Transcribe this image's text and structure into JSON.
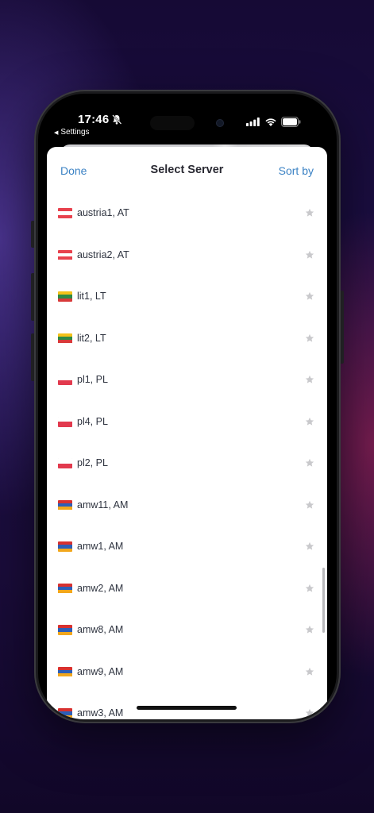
{
  "status_bar": {
    "time": "17:46",
    "back_label": "Settings"
  },
  "nav": {
    "done": "Done",
    "title": "Select Server",
    "sort": "Sort by"
  },
  "servers": [
    {
      "label": "austria1, AT",
      "country": "AT"
    },
    {
      "label": "austria2, AT",
      "country": "AT"
    },
    {
      "label": "lit1, LT",
      "country": "LT"
    },
    {
      "label": "lit2, LT",
      "country": "LT"
    },
    {
      "label": "pl1, PL",
      "country": "PL"
    },
    {
      "label": "pl4, PL",
      "country": "PL"
    },
    {
      "label": "pl2, PL",
      "country": "PL"
    },
    {
      "label": "amw11, AM",
      "country": "AM"
    },
    {
      "label": "amw1, AM",
      "country": "AM"
    },
    {
      "label": "amw2, AM",
      "country": "AM"
    },
    {
      "label": "amw8, AM",
      "country": "AM"
    },
    {
      "label": "amw9, AM",
      "country": "AM"
    },
    {
      "label": "amw3, AM",
      "country": "AM"
    }
  ],
  "flag_colors": {
    "AT": [
      "#e8424e",
      "#ffffff",
      "#e8424e"
    ],
    "LT": [
      "#f4c21a",
      "#2e8a46",
      "#d83a3a"
    ],
    "PL": [
      "#ffffff",
      "#e23a4e"
    ],
    "AM": [
      "#d8312f",
      "#2d5fb8",
      "#f2a71c"
    ]
  },
  "colors": {
    "accent": "#3b82c4",
    "star": "#c9c9cc"
  }
}
